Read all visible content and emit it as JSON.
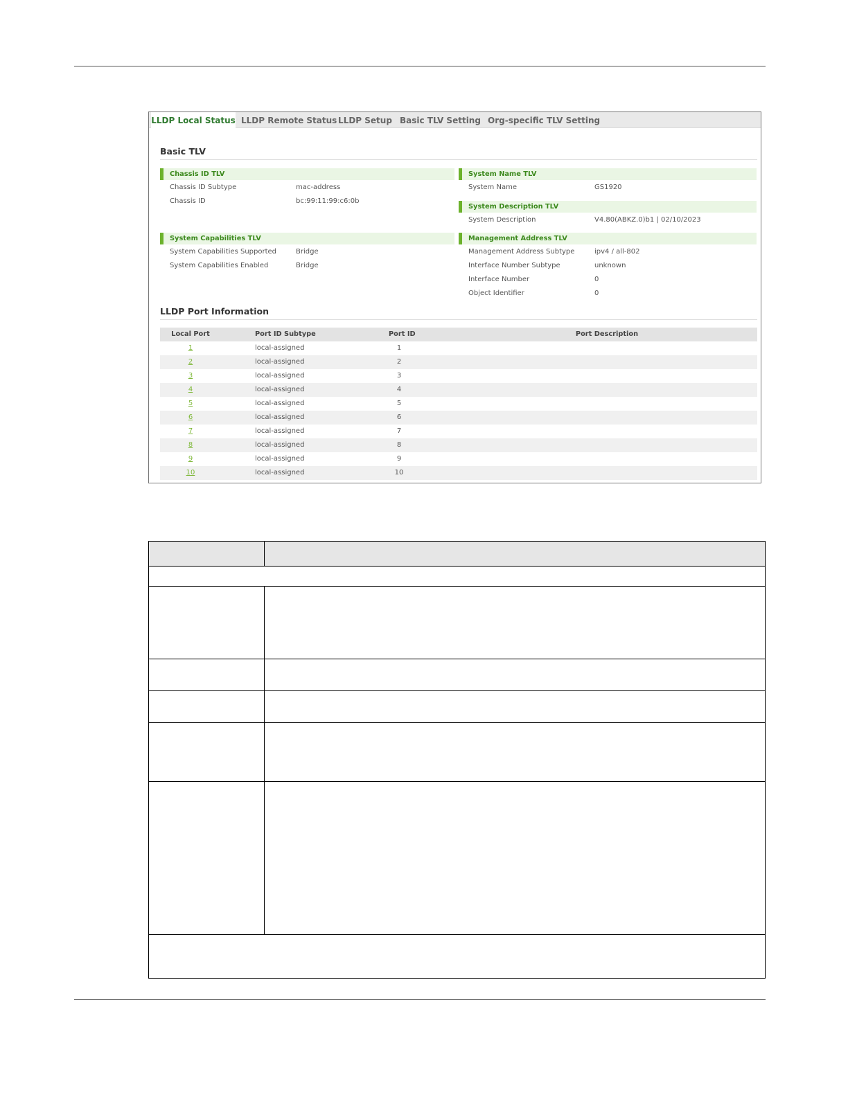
{
  "tabs": [
    {
      "label": "LLDP Local Status",
      "active": true
    },
    {
      "label": "LLDP Remote Status",
      "active": false
    },
    {
      "label": "LLDP Setup",
      "active": false
    },
    {
      "label": "Basic TLV Setting",
      "active": false
    },
    {
      "label": "Org-specific TLV Setting",
      "active": false
    }
  ],
  "basic_tlv": {
    "title": "Basic TLV",
    "chassis": {
      "header": "Chassis ID TLV",
      "subtype_label": "Chassis ID Subtype",
      "subtype_value": "mac-address",
      "id_label": "Chassis ID",
      "id_value": "bc:99:11:99:c6:0b"
    },
    "system_name": {
      "header": "System Name TLV",
      "label": "System Name",
      "value": "GS1920"
    },
    "system_description": {
      "header": "System Description TLV",
      "label": "System Description",
      "value": "V4.80(ABKZ.0)b1 | 02/10/2023"
    },
    "capabilities": {
      "header": "System Capabilities TLV",
      "supported_label": "System Capabilities Supported",
      "supported_value": "Bridge",
      "enabled_label": "System Capabilities Enabled",
      "enabled_value": "Bridge"
    },
    "management": {
      "header": "Management Address TLV",
      "addr_subtype_label": "Management Address Subtype",
      "addr_subtype_value": "ipv4 / all-802",
      "if_subtype_label": "Interface Number Subtype",
      "if_subtype_value": "unknown",
      "if_number_label": "Interface Number",
      "if_number_value": "0",
      "oid_label": "Object Identifier",
      "oid_value": "0"
    }
  },
  "port_info": {
    "title": "LLDP Port Information",
    "columns": [
      "Local Port",
      "Port ID Subtype",
      "Port ID",
      "Port Description"
    ],
    "rows": [
      {
        "local_port": "1",
        "subtype": "local-assigned",
        "port_id": "1",
        "description": ""
      },
      {
        "local_port": "2",
        "subtype": "local-assigned",
        "port_id": "2",
        "description": ""
      },
      {
        "local_port": "3",
        "subtype": "local-assigned",
        "port_id": "3",
        "description": ""
      },
      {
        "local_port": "4",
        "subtype": "local-assigned",
        "port_id": "4",
        "description": ""
      },
      {
        "local_port": "5",
        "subtype": "local-assigned",
        "port_id": "5",
        "description": ""
      },
      {
        "local_port": "6",
        "subtype": "local-assigned",
        "port_id": "6",
        "description": ""
      },
      {
        "local_port": "7",
        "subtype": "local-assigned",
        "port_id": "7",
        "description": ""
      },
      {
        "local_port": "8",
        "subtype": "local-assigned",
        "port_id": "8",
        "description": ""
      },
      {
        "local_port": "9",
        "subtype": "local-assigned",
        "port_id": "9",
        "description": ""
      },
      {
        "local_port": "10",
        "subtype": "local-assigned",
        "port_id": "10",
        "description": ""
      }
    ]
  },
  "colors": {
    "accent_green": "#6cb22c",
    "tab_active_text": "#2f7a2f",
    "link_green": "#7fb83a"
  }
}
